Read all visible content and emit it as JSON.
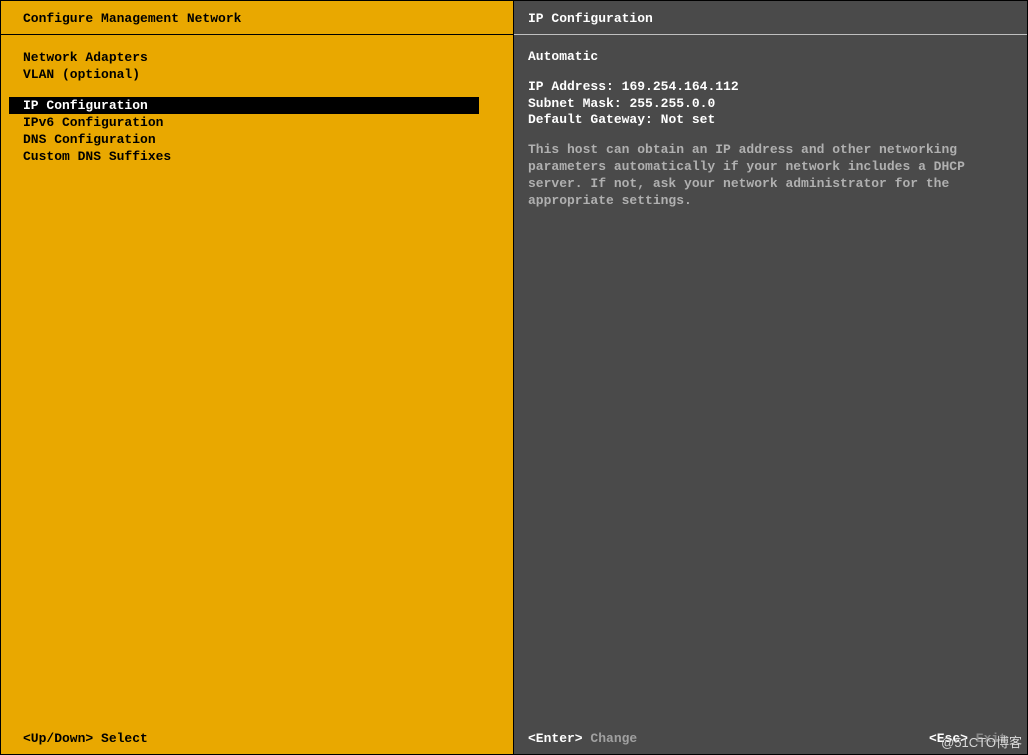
{
  "left": {
    "title": "Configure Management Network",
    "groups": [
      {
        "items": [
          {
            "label": "Network Adapters",
            "selected": false
          },
          {
            "label": "VLAN (optional)",
            "selected": false
          }
        ]
      },
      {
        "items": [
          {
            "label": "IP Configuration",
            "selected": true
          },
          {
            "label": "IPv6 Configuration",
            "selected": false
          },
          {
            "label": "DNS Configuration",
            "selected": false
          },
          {
            "label": "Custom DNS Suffixes",
            "selected": false
          }
        ]
      }
    ]
  },
  "right": {
    "title": "IP Configuration",
    "mode": "Automatic",
    "fields": {
      "ip_address_label": "IP Address:",
      "ip_address_value": "169.254.164.112",
      "subnet_mask_label": "Subnet Mask:",
      "subnet_mask_value": "255.255.0.0",
      "default_gateway_label": "Default Gateway:",
      "default_gateway_value": "Not set"
    },
    "help": "This host can obtain an IP address and other networking parameters automatically if your network includes a DHCP server. If not, ask your network administrator for the appropriate settings."
  },
  "footer": {
    "left_key": "<Up/Down>",
    "left_label": "Select",
    "enter_key": "<Enter>",
    "enter_label": "Change",
    "esc_key": "<Esc>",
    "esc_label": "Exit"
  },
  "watermark": "@51CTO博客"
}
